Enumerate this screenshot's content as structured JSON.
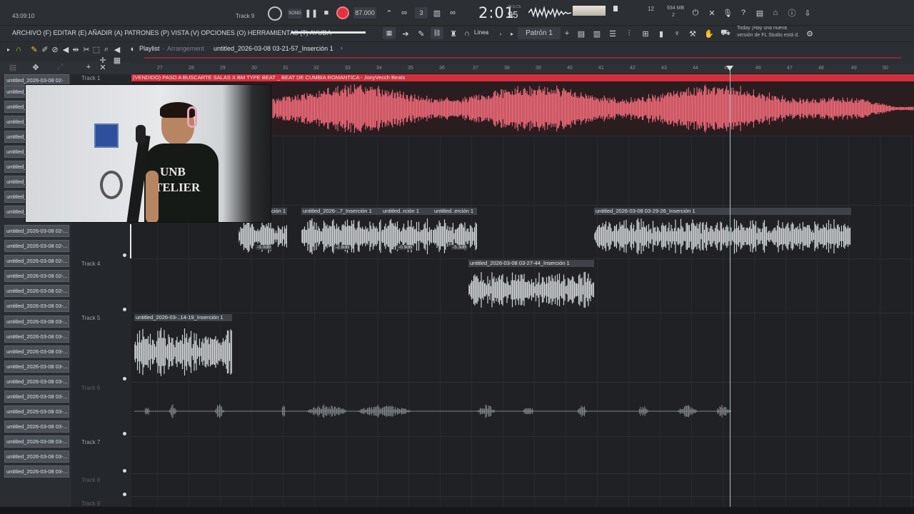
{
  "topbar": {
    "time_small": "43:09:10",
    "pattern_label": "Track 9",
    "song_mode": "SONG",
    "tempo": "87.000",
    "time_main": "2:01",
    "time_sub": "95",
    "time_unit": "M:S:CS",
    "cpu_value": "12",
    "mem_value": "934 MB",
    "mem_sub": "2",
    "hint_line1": "Today ¡Hay una nueva",
    "hint_line2": "versión de FL Studio está d."
  },
  "menu": {
    "items": "ARCHIVO (F) EDITAR (E) AÑADIR (A) PATRONES (P) VISTA (V) OPCIONES (O) HERRAMIENTAS (T) AYUDA",
    "snap": "Línea",
    "pattern": "Patrón 1"
  },
  "playlist": {
    "title": "Playlist",
    "subtitle": "Arrangement",
    "clip_name": "untitled_2026-03-08 03-21-57_Inserción 1",
    "ruler": [
      "27",
      "28",
      "29",
      "30",
      "31",
      "32",
      "33",
      "34",
      "35",
      "36",
      "37",
      "38",
      "39",
      "40",
      "41",
      "42",
      "43",
      "44",
      "45",
      "46",
      "47",
      "48",
      "49",
      "50"
    ]
  },
  "browser": {
    "items": [
      "untitled_2026-03-08 02-",
      "untitled_2026-03-08 02-",
      "untitled_2026-03-08 02-",
      "untitled_2026-03-08 02-",
      "untitled_2026-03-08 02-",
      "untitled_2026-03-08 02-",
      "untitled_2026-03-08 02-",
      "untitled_2026-03-08 02-",
      "untitled_2026-03-08 02-",
      "untitled_2026-03-08 02-...",
      "untitled_2026-03-08 02-...",
      "untitled_2026-03-08 02-...",
      "untitled_2026-03-08 02-...",
      "untitled_2026-03-08 02-...",
      "untitled_2026-03-08 02-...",
      "untitled_2026-03-08 03-...",
      "untitled_2026-03-08 03-...",
      "untitled_2026-03-08 03-...",
      "untitled_2026-03-08 03-...",
      "untitled_2026-03-08 03-...",
      "untitled_2026-03-08 03-...",
      "untitled_2026-03-08 03-...",
      "untitled_2026-03-08 03-...",
      "untitled_2026-03-08 03-...",
      "untitled_2026-03-08 03-...",
      "untitled_2026-03-08 03-...",
      "untitled_2026-03-08 03-..."
    ]
  },
  "tracks": {
    "t1": "Track 1",
    "t4": "Track 4",
    "t5": "Track 5",
    "t6": "Track 6",
    "t7": "Track 7",
    "t8": "Track 8",
    "t9": "Track 9"
  },
  "clips": {
    "beat": "(VENDIDO) PASO A BUSCARTE SALAS X BM TYPE BEAT _ BEAT DE CUMBIA ROMANTICA - JonyVecch Beats",
    "t3a": "ción 1",
    "t3b": "untitled_2026-..7_Inserción 1",
    "t3c": "untitled..rción 1",
    "t3d": "untitled..erción 1",
    "t3e": "untitled_2026-03-08 03-29-26_Inserción 1",
    "t4a": "untitled_2026-03-08 03-27-44_Inserción 1",
    "t5a": "untitled_2026-03-..14-19_Inserción 1",
    "vol1": "-3.0dB",
    "vol2": "-2.8dB",
    "vol3": "-0.9dB",
    "vol4": "-5.3dB"
  },
  "webcam": {
    "shirt_text_1": "UNB",
    "shirt_text_2": "TELIER"
  },
  "colors": {
    "beat_clip": "#f06a78",
    "vocal_clip": "#cfd3d6",
    "accent_red": "#e0333e"
  }
}
